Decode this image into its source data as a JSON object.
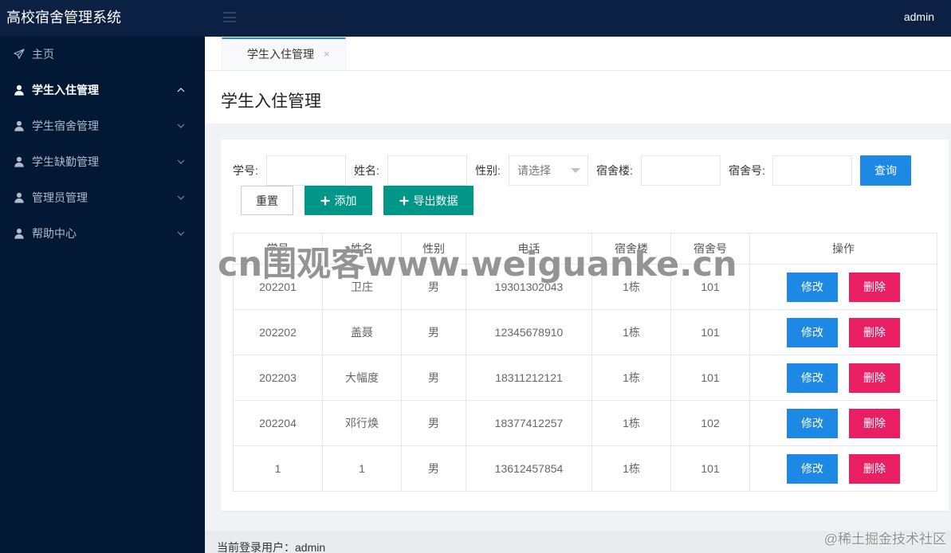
{
  "app": {
    "title": "高校宿舍管理系统",
    "current_user": "admin",
    "menu_icon": "hamburger-icon"
  },
  "colors": {
    "header_bg": "#0b2043",
    "sidebar_bg": "#031834",
    "primary": "#1e88e5",
    "teal": "#009688",
    "danger": "#e91e63"
  },
  "sidebar": {
    "items": [
      {
        "label": "主页",
        "icon": "paper-plane-icon"
      },
      {
        "label": "学生入住管理",
        "icon": "user-icon",
        "chevron": "chevron-up-icon"
      },
      {
        "label": "学生宿舍管理",
        "icon": "user-icon",
        "chevron": "chevron-down-icon"
      },
      {
        "label": "学生缺勤管理",
        "icon": "user-icon",
        "chevron": "chevron-down-icon"
      },
      {
        "label": "管理员管理",
        "icon": "user-icon",
        "chevron": "chevron-down-icon"
      },
      {
        "label": "帮助中心",
        "icon": "user-icon",
        "chevron": "chevron-down-icon"
      }
    ]
  },
  "tabs": [
    {
      "label": "学生入住管理",
      "close": "×"
    }
  ],
  "page": {
    "title": "学生入住管理"
  },
  "search": {
    "fields": [
      {
        "label": "学号:",
        "value": ""
      },
      {
        "label": "姓名:",
        "value": ""
      },
      {
        "label": "性别:",
        "placeholder": "请选择",
        "icon": "caret-down-icon"
      },
      {
        "label": "宿舍楼:",
        "value": ""
      },
      {
        "label": "宿舍号:",
        "value": ""
      }
    ],
    "query_label": "查询",
    "reset_label": "重置",
    "add_label": "添加",
    "export_label": "导出数据",
    "button_icon": "plus-icon"
  },
  "table": {
    "columns": [
      "学号",
      "姓名",
      "性别",
      "电话",
      "宿舍楼",
      "宿舍号",
      "操作"
    ],
    "rows": [
      {
        "student_id": "202201",
        "name": "卫庄",
        "gender": "男",
        "phone": "19301302043",
        "building": "1栋",
        "room": "101"
      },
      {
        "student_id": "202202",
        "name": "盖聂",
        "gender": "男",
        "phone": "12345678910",
        "building": "1栋",
        "room": "101"
      },
      {
        "student_id": "202203",
        "name": "大幅度",
        "gender": "男",
        "phone": "18311212121",
        "building": "1栋",
        "room": "101"
      },
      {
        "student_id": "202204",
        "name": "邓行焕",
        "gender": "男",
        "phone": "18377412257",
        "building": "1栋",
        "room": "102"
      },
      {
        "student_id": "1",
        "name": "1",
        "gender": "男",
        "phone": "13612457854",
        "building": "1栋",
        "room": "101"
      }
    ],
    "actions": {
      "edit": "修改",
      "delete": "删除"
    }
  },
  "footer": {
    "text": "当前登录用户：admin"
  },
  "watermarks": {
    "overlay": "cn围观客www.weiguanke.cn",
    "corner": "@稀土掘金技术社区"
  }
}
